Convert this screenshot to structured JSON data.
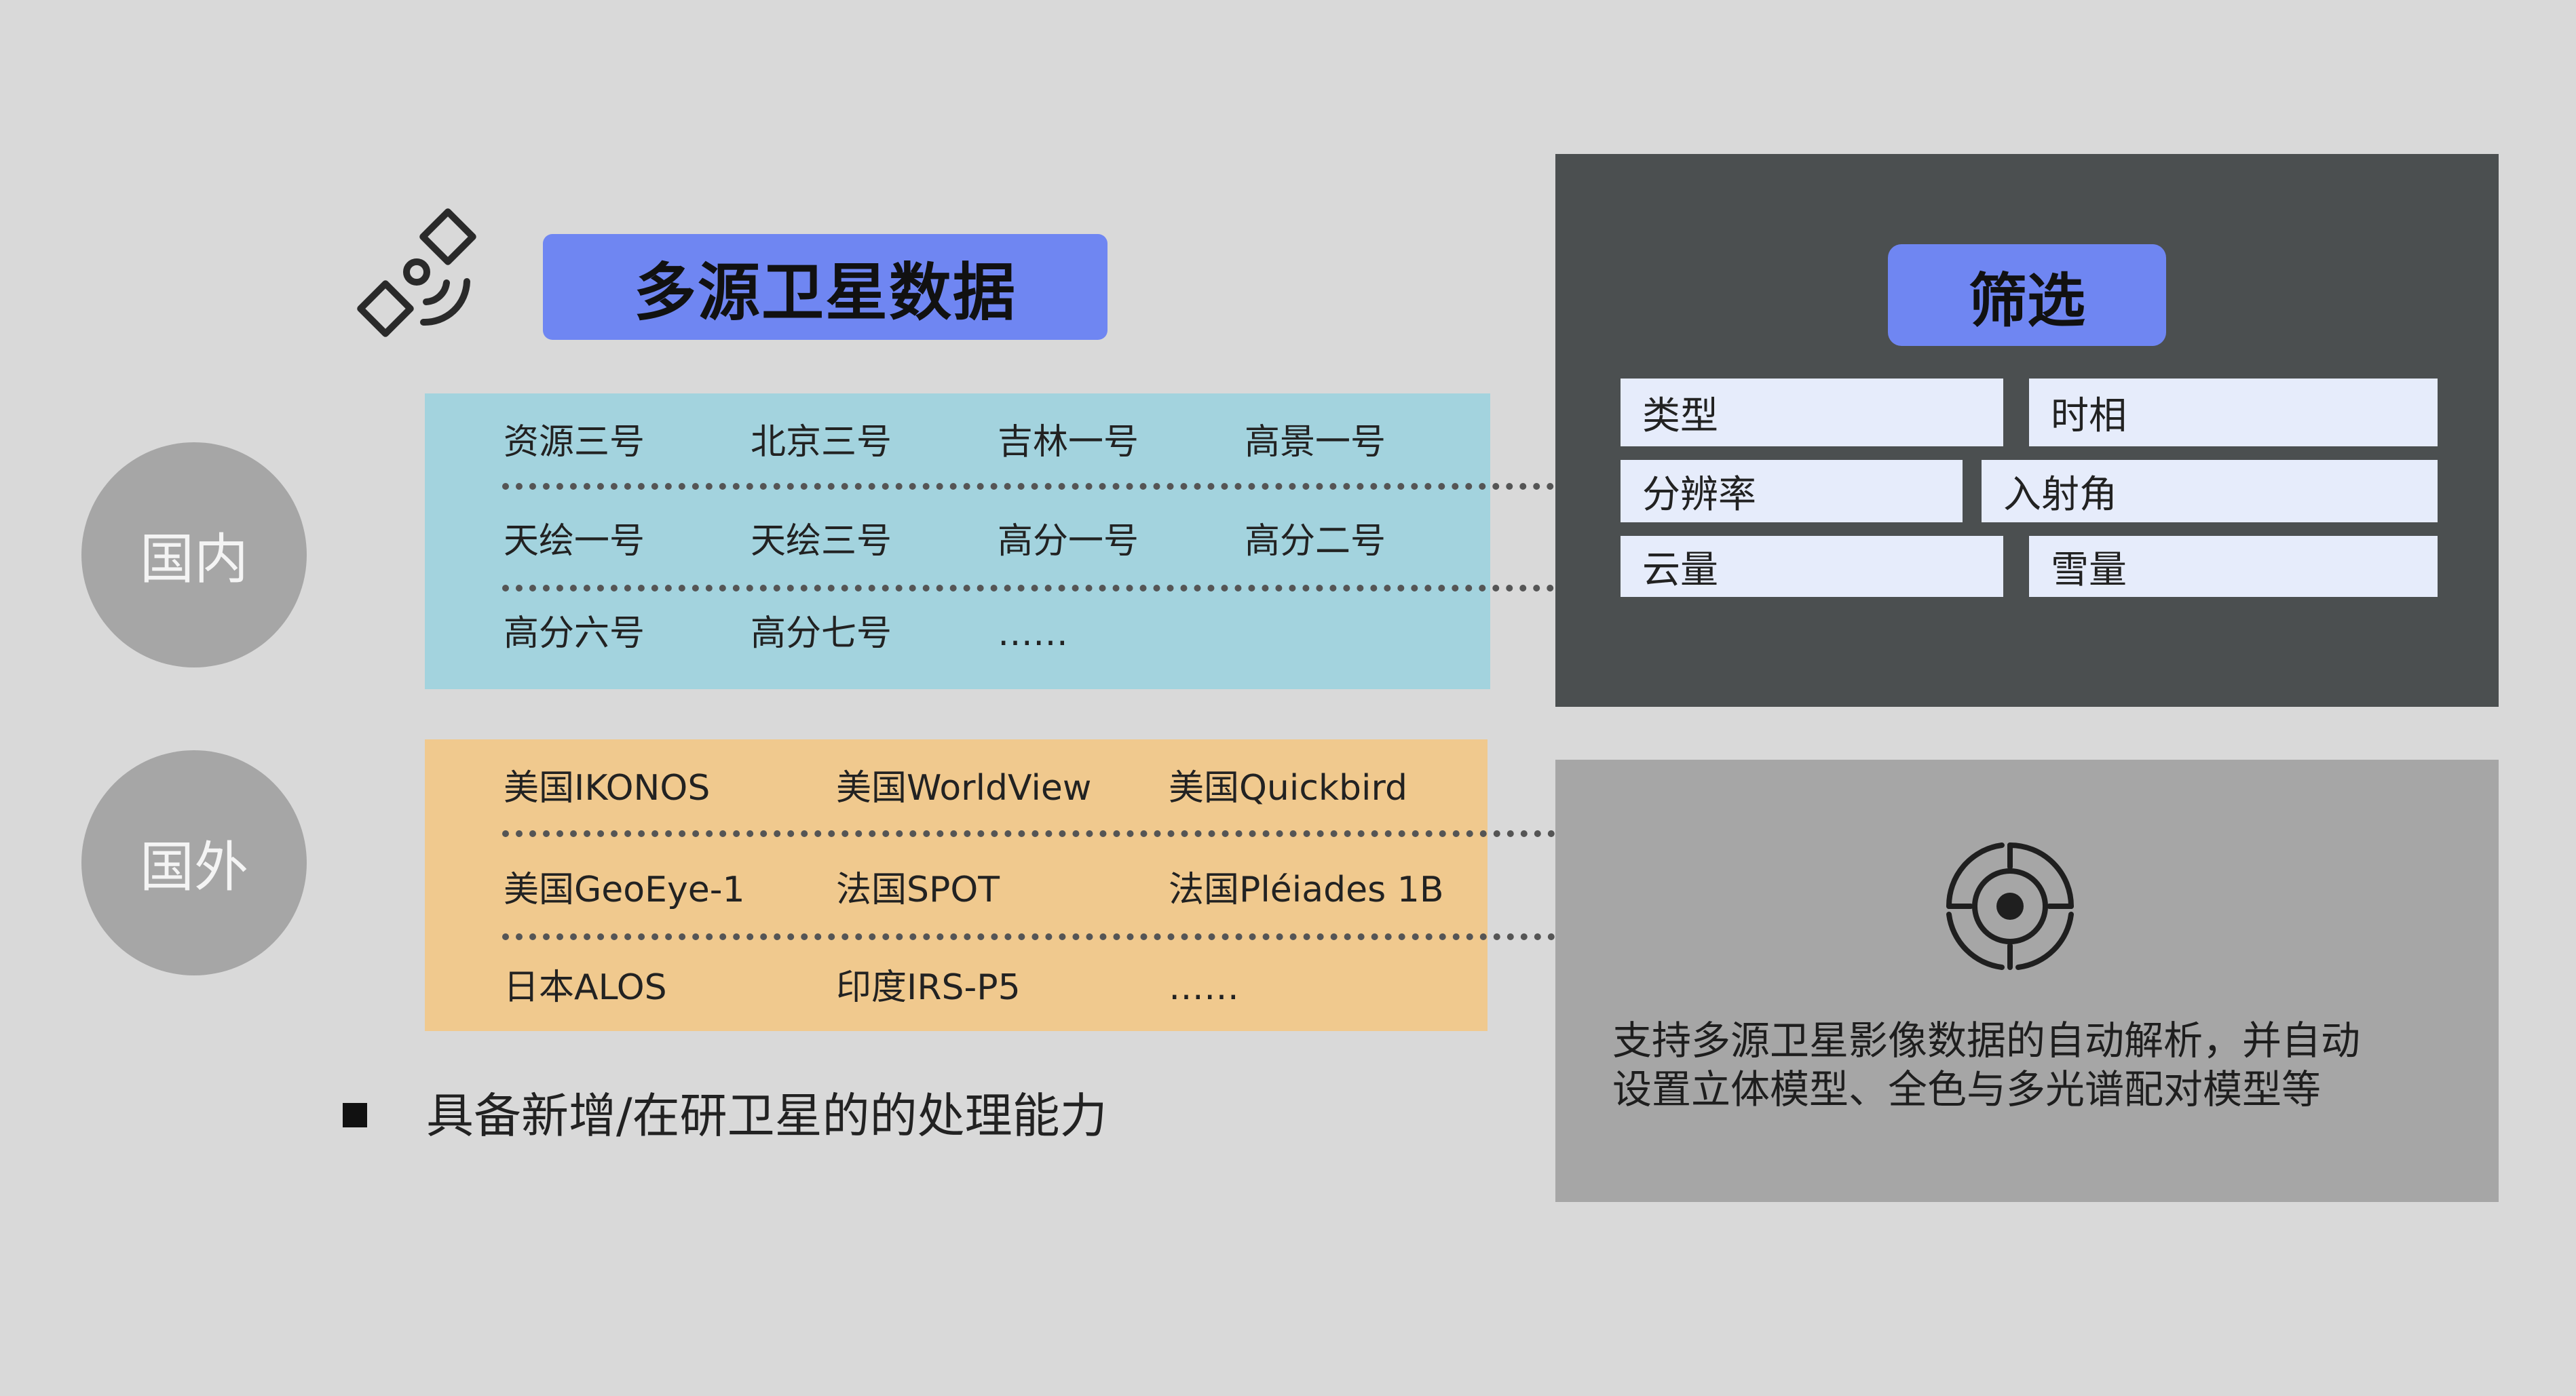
{
  "header": {
    "icon": "satellite-icon",
    "title": "多源卫星数据"
  },
  "categories": {
    "domestic": "国内",
    "foreign": "国外"
  },
  "domestic_satellites": [
    [
      "资源三号",
      "北京三号",
      "吉林一号",
      "高景一号"
    ],
    [
      "天绘一号",
      "天绘三号",
      "高分一号",
      "高分二号"
    ],
    [
      "高分六号",
      "高分七号",
      "……"
    ]
  ],
  "foreign_satellites": [
    [
      "美国IKONOS",
      "美国WorldView",
      "美国Quickbird"
    ],
    [
      "美国GeoEye-1",
      "法国SPOT",
      "法国Pléiades 1B"
    ],
    [
      "日本ALOS",
      "印度IRS-P5",
      "……"
    ]
  ],
  "bullet": {
    "text": "具备新增/在研卫星的的处理能力"
  },
  "filter": {
    "title": "筛选",
    "options": [
      "类型",
      "时相",
      "分辨率",
      "入射角",
      "云量",
      "雪量"
    ]
  },
  "description": {
    "icon": "target-icon",
    "lines": [
      "支持多源卫星影像数据的自动解析，并自动",
      "设置立体模型、全色与多光谱配对模型等"
    ]
  },
  "colors": {
    "background": "#d9d9d9",
    "accent_pill": "#6f86f2",
    "domestic_panel": "#a3d3de",
    "foreign_panel": "#f0c98e",
    "filter_panel": "#4b4f50",
    "filter_box": "#e6ecfb",
    "description_panel": "#a6a6a6",
    "circle": "#a6a6a6"
  }
}
